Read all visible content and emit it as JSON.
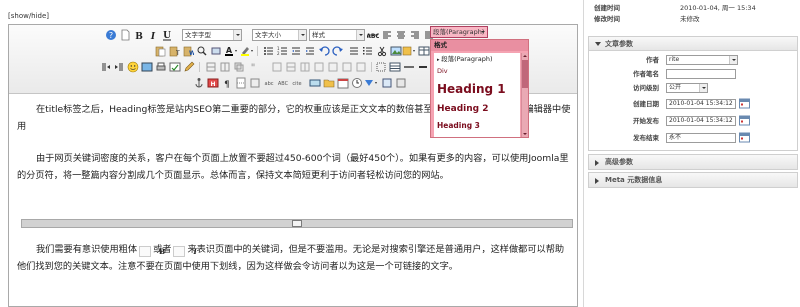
{
  "editor": {
    "show_hide": "[show/hide]",
    "toolbar": {
      "font_family": "文字字型",
      "font_size": "文字大小",
      "styles": "样式",
      "format": "段落(Paragraph)"
    },
    "format_dropdown": {
      "header": "格式",
      "items": [
        "段落(Paragraph)",
        "Div",
        "Heading 1",
        "Heading 2",
        "Heading 3"
      ]
    },
    "content": {
      "para1": "在title标签之后，Heading标签是站内SEO第二重要的部分，它的权重应该是正文文本的数倍甚至数十倍以上。很多网站编辑器中使用",
      "para2": "由于网页关键词密度的关系，客户在每个页面上放置不要超过450-600个词（最好450个）。如果有更多的内容，可以使用Joomla里的分页符，将一整篇内容分割成几个页面显示。总体而言，保持文本简短更利于访问者轻松访问您的网站。",
      "para3_a": "我们需要有意识使用粗体",
      "para3_bold_glyph": "B",
      "para3_b": "或者",
      "para3_italic_glyph": "I",
      "para3_c": "来表识页面中的关键词，但是不要滥用。无论是对搜索引擎还是普通用户，这样做都可以帮助他们找到您的关键文本。注意不要在页面中使用下划线，因为这样做会令访问者以为这是一个可链接的文字。"
    }
  },
  "sidebar": {
    "meta": [
      {
        "key": "创建时间",
        "value": "2010-01-04, 周一 15:34"
      },
      {
        "key": "修改时间",
        "value": "未修改"
      }
    ],
    "article_params": {
      "title": "文章参数",
      "fields": [
        {
          "label": "作者",
          "value": "rite",
          "kind": "select"
        },
        {
          "label": "作者笔名",
          "value": "",
          "kind": "text"
        },
        {
          "label": "访问级别",
          "value": "公开",
          "kind": "select"
        },
        {
          "label": "创建日期",
          "value": "2010-01-04 15:34:12",
          "kind": "date"
        },
        {
          "label": "开始发布",
          "value": "2010-01-04 15:34:12",
          "kind": "date"
        },
        {
          "label": "发布结束",
          "value": "永不",
          "kind": "date"
        }
      ]
    },
    "advanced_params": {
      "title": "高级参数"
    },
    "meta_info": {
      "title": "Meta 元数据信息"
    }
  },
  "colors": {
    "format_highlight": "#f5a3b2",
    "format_text": "#7b0d1e",
    "toolbar_bg": "#eeeeee",
    "panel_border": "#cfcfcf"
  }
}
